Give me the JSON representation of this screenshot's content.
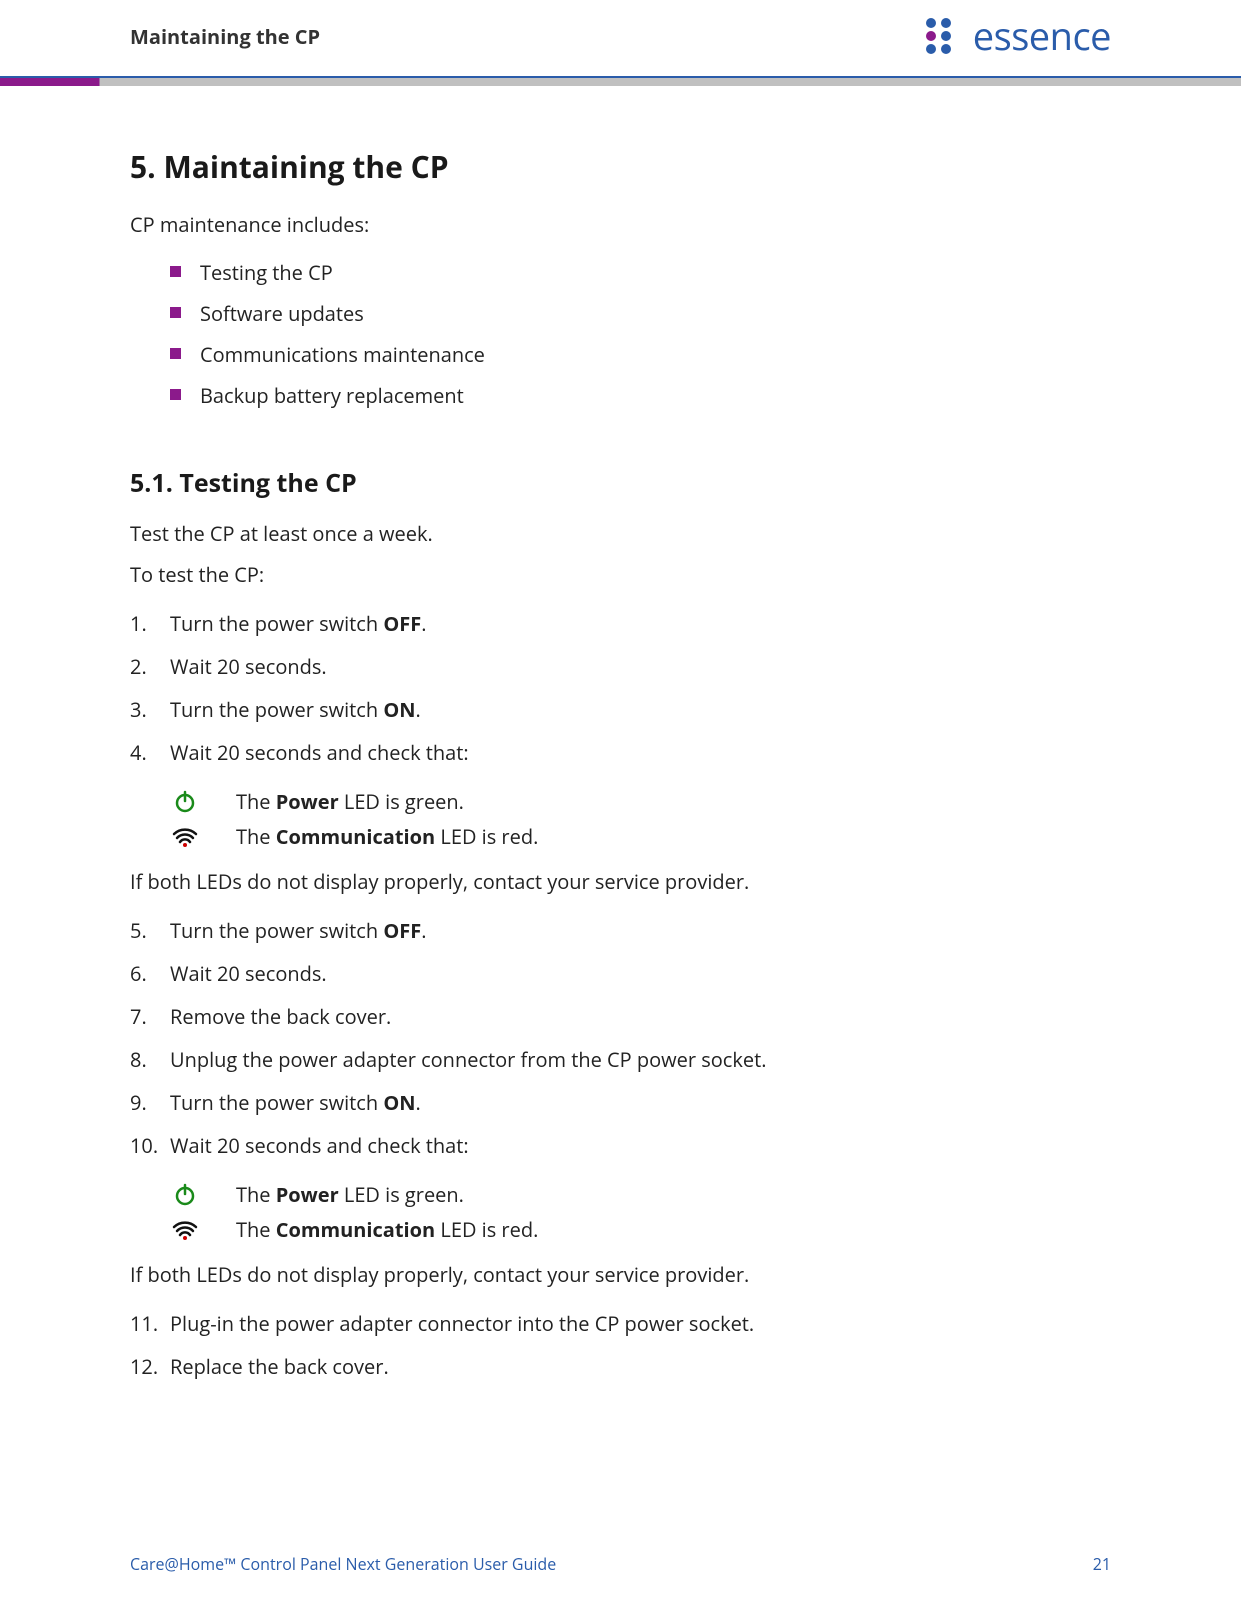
{
  "header": {
    "title": "Maintaining the CP",
    "logo_text": "essence"
  },
  "section": {
    "number_title": "5.   Maintaining the CP",
    "intro": "CP maintenance includes:",
    "bullets": [
      "Testing the CP",
      "Software updates",
      "Communications maintenance",
      "Backup battery replacement"
    ]
  },
  "sub": {
    "number_title": "5.1.   Testing the CP",
    "intro": "Test the CP at least once a week.",
    "lead": "To test the CP:"
  },
  "steps": {
    "s1_pre": "Turn the power switch ",
    "s1_bold": "OFF",
    "s1_post": ".",
    "s2": "Wait 20 seconds.",
    "s3_pre": "Turn the power switch ",
    "s3_bold": "ON",
    "s3_post": ".",
    "s4": "Wait 20 seconds and check that:",
    "led1_pre": "The ",
    "led1_bold": "Power",
    "led1_post": " LED is green.",
    "led2_pre": "The ",
    "led2_bold": "Communication",
    "led2_post": " LED is red.",
    "interject1": "If both LEDs do not display properly, contact your service provider.",
    "s5_pre": "Turn the power switch ",
    "s5_bold": "OFF",
    "s5_post": ".",
    "s6": "Wait 20 seconds.",
    "s7": "Remove the back cover.",
    "s8": "Unplug the power adapter connector from the CP power socket.",
    "s9_pre": "Turn the power switch ",
    "s9_bold": "ON",
    "s9_post": ".",
    "s10": "Wait 20 seconds and check that:",
    "interject2": "If both LEDs do not display properly, contact your service provider.",
    "s11": "Plug-in the power adapter connector into the CP power socket.",
    "s12": "Replace the back cover."
  },
  "footer": {
    "left": "Care@Home™ Control Panel Next Generation User Guide",
    "right": "21"
  }
}
